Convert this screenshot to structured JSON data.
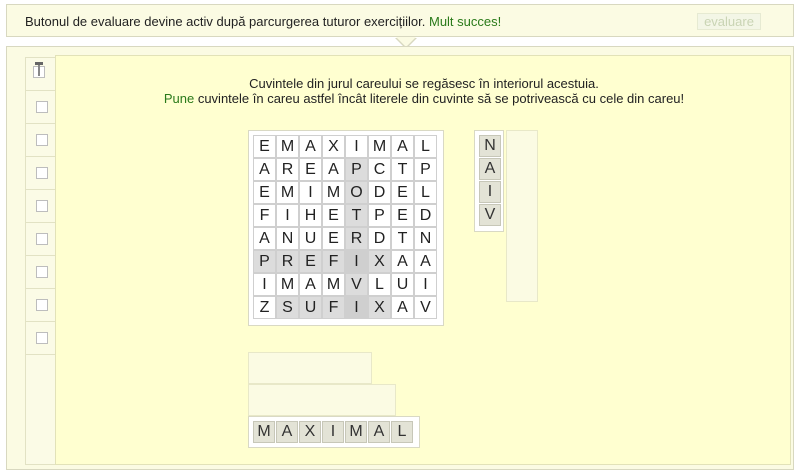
{
  "topbar": {
    "message": "Butonul de evaluare devine activ după parcurgerea tuturor exercițiilor.",
    "success": "Mult succes!",
    "evaluate_label": "evaluare"
  },
  "instructions": {
    "line1": "Cuvintele din jurul careului se regăsesc în interiorul acestuia.",
    "line2_highlight": "Pune",
    "line2_rest": " cuvintele în careu astfel încât literele din cuvinte să se potrivească cu cele din careu!"
  },
  "checklist": {
    "count": 9
  },
  "grid": {
    "rows": [
      [
        "E",
        "M",
        "A",
        "X",
        "I",
        "M",
        "A",
        "L"
      ],
      [
        "A",
        "R",
        "E",
        "A",
        "P",
        "C",
        "T",
        "P"
      ],
      [
        "E",
        "M",
        "I",
        "M",
        "O",
        "D",
        "E",
        "L"
      ],
      [
        "F",
        "I",
        "H",
        "E",
        "T",
        "P",
        "E",
        "D"
      ],
      [
        "A",
        "N",
        "U",
        "E",
        "R",
        "D",
        "T",
        "N"
      ],
      [
        "P",
        "R",
        "E",
        "F",
        "I",
        "X",
        "A",
        "A"
      ],
      [
        "I",
        "M",
        "A",
        "M",
        "V",
        "L",
        "U",
        "I"
      ],
      [
        "Z",
        "S",
        "U",
        "F",
        "I",
        "X",
        "A",
        "V"
      ]
    ],
    "shaded": [
      [
        1,
        4
      ],
      [
        2,
        4
      ],
      [
        3,
        4
      ],
      [
        4,
        4
      ],
      [
        5,
        4
      ],
      [
        6,
        4
      ],
      [
        7,
        4
      ],
      [
        5,
        0
      ],
      [
        5,
        1
      ],
      [
        5,
        2
      ],
      [
        5,
        3
      ],
      [
        5,
        5
      ],
      [
        7,
        1
      ],
      [
        7,
        2
      ],
      [
        7,
        3
      ],
      [
        7,
        5
      ]
    ],
    "dark": [
      [
        5,
        4
      ],
      [
        7,
        4
      ]
    ]
  },
  "vertical_word": {
    "letters": [
      "N",
      "A",
      "I",
      "V"
    ]
  },
  "horizontal_word": {
    "letters": [
      "M",
      "A",
      "X",
      "I",
      "M",
      "A",
      "L"
    ]
  }
}
